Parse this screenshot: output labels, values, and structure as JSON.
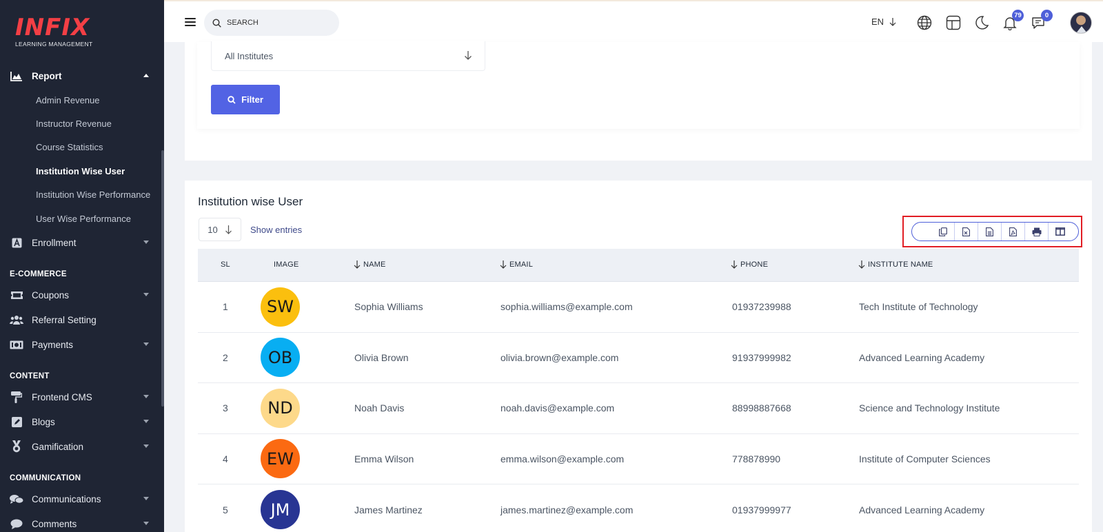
{
  "sidebar": {
    "logo_main": "INFIX",
    "logo_sub": "LEARNING MANAGEMENT",
    "report": {
      "label": "Report",
      "children": [
        "Admin Revenue",
        "Instructor Revenue",
        "Course Statistics",
        "Institution Wise User",
        "Institution Wise Performance",
        "User Wise Performance"
      ]
    },
    "enrollment": "Enrollment",
    "section_ecommerce": "E-COMMERCE",
    "coupons": "Coupons",
    "referral": "Referral Setting",
    "payments": "Payments",
    "section_content": "CONTENT",
    "frontend_cms": "Frontend CMS",
    "blogs": "Blogs",
    "gamification": "Gamification",
    "section_communication": "COMMUNICATION",
    "communications": "Communications",
    "comments": "Comments"
  },
  "header": {
    "search_placeholder": "SEARCH",
    "language": "EN",
    "notifications_count": "79",
    "messages_count": "0"
  },
  "filter": {
    "institute_select": "All Institutes",
    "filter_button": "Filter"
  },
  "table": {
    "title": "Institution wise User",
    "page_size": "10",
    "show_entries": "Show entries",
    "columns": {
      "sl": "SL",
      "image": "IMAGE",
      "name": "NAME",
      "email": "EMAIL",
      "phone": "PHONE",
      "institute": "INSTITUTE NAME"
    },
    "rows": [
      {
        "sl": "1",
        "initials": "SW",
        "avatar_color": "#fbbf0e",
        "name": "Sophia Williams",
        "email": "sophia.williams@example.com",
        "phone": "01937239988",
        "institute": "Tech Institute of Technology"
      },
      {
        "sl": "2",
        "initials": "OB",
        "avatar_color": "#08aef2",
        "name": "Olivia Brown",
        "email": "olivia.brown@example.com",
        "phone": "91937999982",
        "institute": "Advanced Learning Academy"
      },
      {
        "sl": "3",
        "initials": "ND",
        "avatar_color": "#fdd98a",
        "name": "Noah Davis",
        "email": "noah.davis@example.com",
        "phone": "88998887668",
        "institute": "Science and Technology Institute"
      },
      {
        "sl": "4",
        "initials": "EW",
        "avatar_color": "#fb6a12",
        "name": "Emma Wilson",
        "email": "emma.wilson@example.com",
        "phone": "778878990",
        "institute": "Institute of Computer Sciences"
      },
      {
        "sl": "5",
        "initials": "JM",
        "avatar_color": "#283593",
        "name": "James Martinez",
        "email": "james.martinez@example.com",
        "phone": "01937999977",
        "institute": "Advanced Learning Academy"
      }
    ]
  },
  "colors": {
    "sidebar_bg": "#1f2534",
    "accent": "#5263e4",
    "logo_red": "#f33f45",
    "highlight": "#e11d24"
  },
  "export_buttons": [
    "copy-icon",
    "excel-icon",
    "csv-icon",
    "pdf-icon",
    "print-icon",
    "columns-icon"
  ]
}
